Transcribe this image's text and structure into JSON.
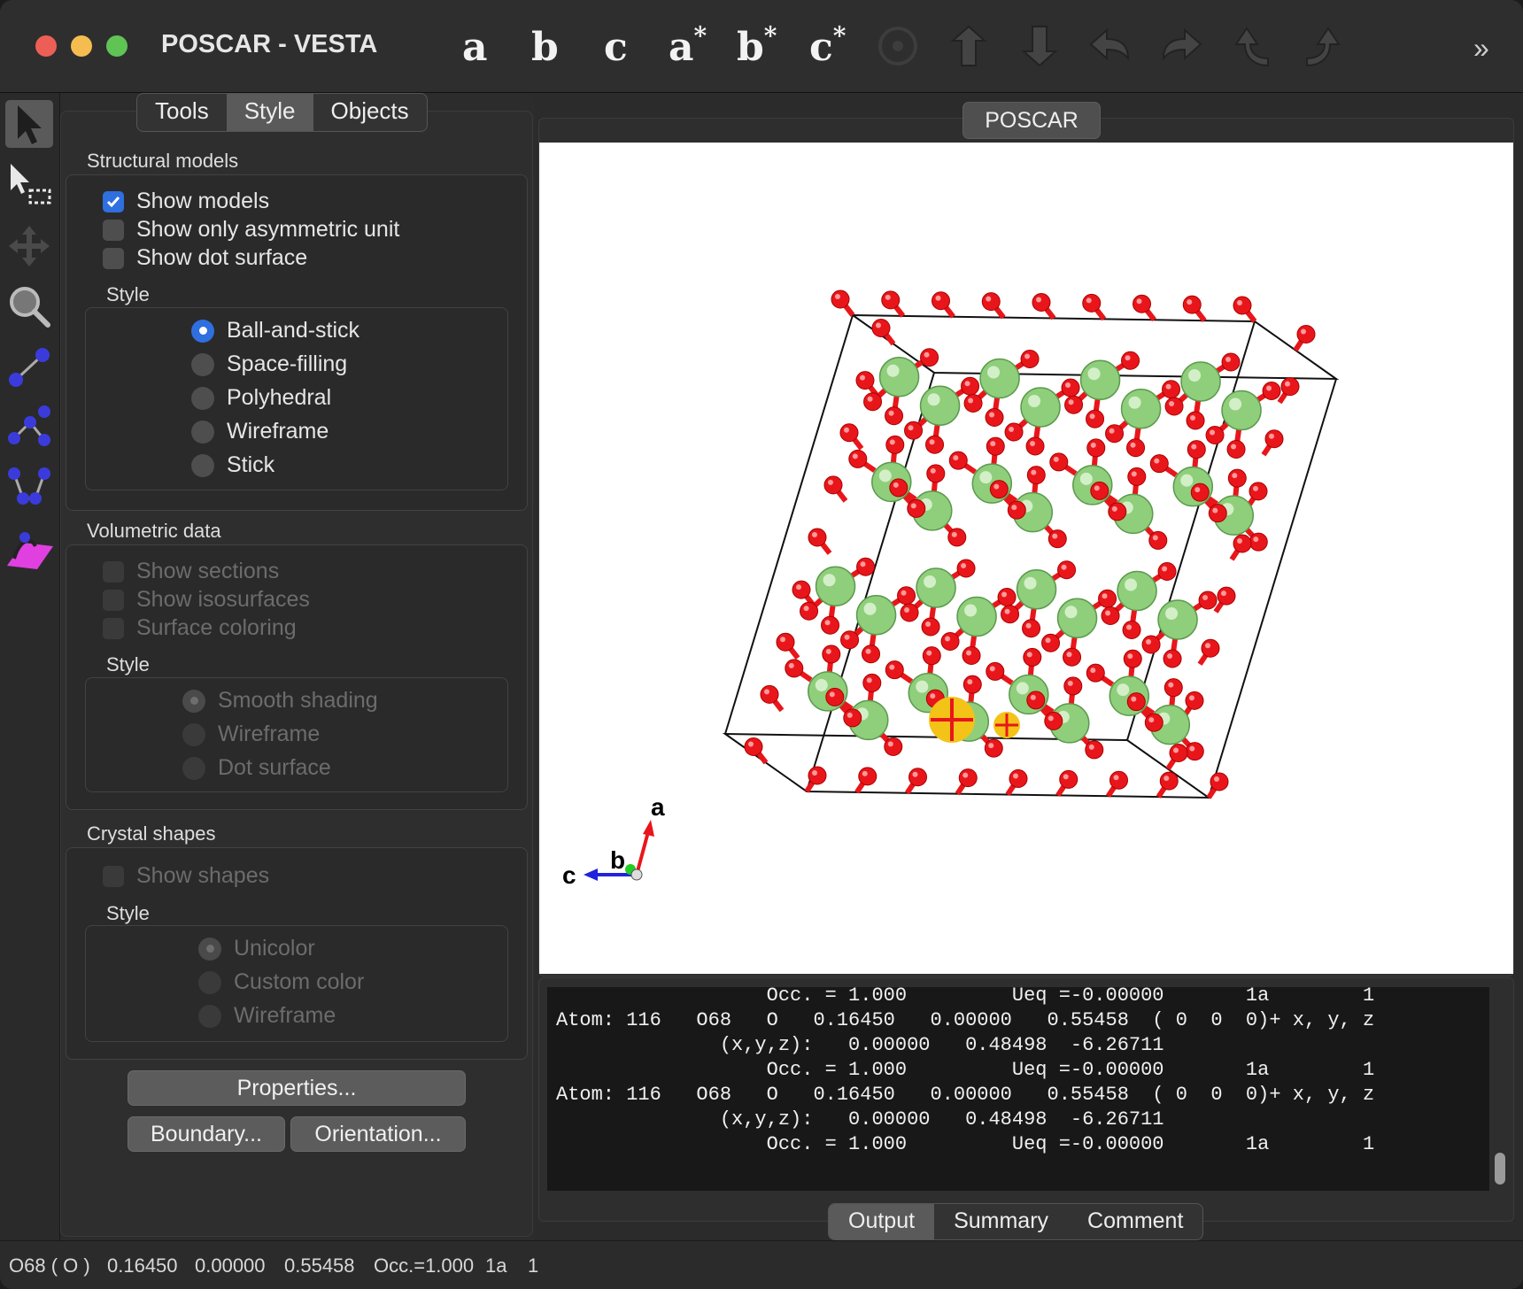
{
  "window": {
    "title": "POSCAR - VESTA"
  },
  "toolbar": {
    "axes": [
      {
        "label": "a",
        "sup": ""
      },
      {
        "label": "b",
        "sup": ""
      },
      {
        "label": "c",
        "sup": ""
      },
      {
        "label": "a",
        "sup": "*"
      },
      {
        "label": "b",
        "sup": "*"
      },
      {
        "label": "c",
        "sup": "*"
      }
    ],
    "overflow": "»"
  },
  "tabs": {
    "tools": "Tools",
    "style": "Style",
    "objects": "Objects",
    "active": "Style"
  },
  "structural": {
    "header": "Structural models",
    "show_models": "Show models",
    "asym": "Show only asymmetric unit",
    "dot": "Show dot surface",
    "style_label": "Style",
    "styles": [
      "Ball-and-stick",
      "Space-filling",
      "Polyhedral",
      "Wireframe",
      "Stick"
    ],
    "selected": "Ball-and-stick"
  },
  "volumetric": {
    "header": "Volumetric data",
    "sections": "Show sections",
    "iso": "Show isosurfaces",
    "coloring": "Surface coloring",
    "style_label": "Style",
    "styles": [
      "Smooth shading",
      "Wireframe",
      "Dot surface"
    ],
    "selected": "Smooth shading"
  },
  "crystal": {
    "header": "Crystal shapes",
    "show": "Show shapes",
    "style_label": "Style",
    "styles": [
      "Unicolor",
      "Custom color",
      "Wireframe"
    ],
    "selected": "Unicolor"
  },
  "buttons": {
    "properties": "Properties...",
    "boundary": "Boundary...",
    "orientation": "Orientation..."
  },
  "view": {
    "tab": "POSCAR",
    "axes": {
      "a": "a",
      "b": "b",
      "c": "c"
    }
  },
  "output": {
    "lines": [
      "                  Occ. = 1.000         Ueq =-0.00000       1a        1",
      "Atom: 116   O68   O   0.16450   0.00000   0.55458  ( 0  0  0)+ x, y, z",
      "              (x,y,z):   0.00000   0.48498  -6.26711",
      "                  Occ. = 1.000         Ueq =-0.00000       1a        1",
      "Atom: 116   O68   O   0.16450   0.00000   0.55458  ( 0  0  0)+ x, y, z",
      "              (x,y,z):   0.00000   0.48498  -6.26711",
      "                  Occ. = 1.000         Ueq =-0.00000       1a        1"
    ],
    "tabs": [
      "Output",
      "Summary",
      "Comment"
    ],
    "active": "Output"
  },
  "status": {
    "atom": "O68 ( O )",
    "x": "0.16450",
    "y": "0.00000",
    "z": "0.55458",
    "occ": "Occ.=1.000",
    "site": "1a",
    "mult": "1"
  },
  "colors": {
    "oxygen": "#e8161b",
    "metal": "#8fcf7b",
    "selected": "#f3c318",
    "accent": "#2f6fe0"
  }
}
